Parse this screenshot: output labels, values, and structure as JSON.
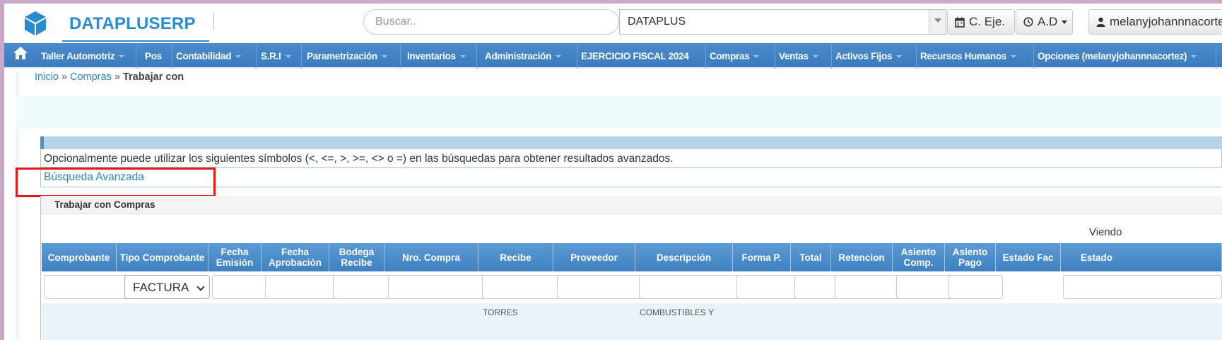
{
  "header": {
    "brand": "DATAPLUSERP",
    "search_placeholder": "Buscar..",
    "company": "DATAPLUS",
    "btn_ejercicio": "C. Eje.",
    "btn_ad": "A.D",
    "btn_user": "melanyjohannnacortez"
  },
  "nav": {
    "items": [
      "Taller Automotriz",
      "Pos",
      "Contabilidad",
      "S.R.I",
      "Parametrización",
      "Inventarios",
      "Administración",
      "EJERCICIO FISCAL 2024",
      "Compras",
      "Ventas",
      "Activos Fijos",
      "Recursos Humanos",
      "Opciones (melanyjohannnacortez)"
    ]
  },
  "breadcrumb": {
    "home": "Inicio",
    "sep": " » ",
    "section": "Compras",
    "current": "Trabajar con"
  },
  "search_panel": {
    "hint": "Opcionalmente puede utilizar los siguientes símbolos (<, <=, >, >=, <> o =) en las búsquedas para obtener resultados avanzados.",
    "advanced": "Búsqueda Avanzada"
  },
  "grid": {
    "title": "Trabajar con Compras",
    "viewing": "Viendo",
    "columns": [
      "Comprobante",
      "Tipo Comprobante",
      "Fecha Emisión",
      "Fecha Aprobación",
      "Bodega Recibe",
      "Nro. Compra",
      "Recibe",
      "Proveedor",
      "Descripción",
      "Forma P.",
      "Total",
      "Retencion",
      "Asiento Comp.",
      "Asiento Pago",
      "Estado Fac",
      "Estado"
    ],
    "filter_tipo": "FACTURA",
    "row1_recibe": "TORRES",
    "row1_descripcion": "COMBUSTIBLES Y"
  }
}
